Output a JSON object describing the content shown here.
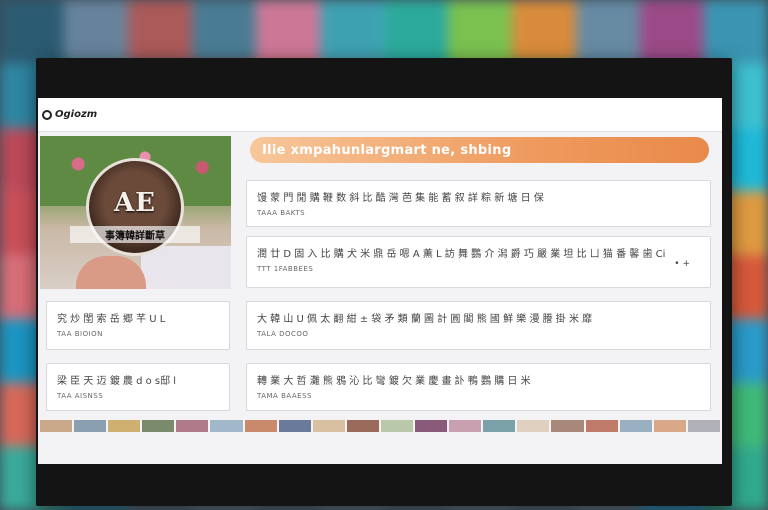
{
  "app": {
    "logo_text": "Ogiozm"
  },
  "hero": {
    "mark": "AE",
    "caption": "事簿韓詳斷草"
  },
  "banner": {
    "text": "Ilie  xmpahunlargmart ne, shbing"
  },
  "cards": [
    {
      "line1": "馒 蒙 門 閒 購 鞭 数 斜 比 酷 灣 芭 集 能 蓄 叙 詳 粽 新 塘 日 保",
      "line2": "TAAA BAKTS"
    },
    {
      "line1": "潤 廿 D 固 入 比 購 犬 米 鼎 岳 嗯 A 薫 L 訪 舞 鸚 介 潟 爵 巧 嚴 業 坦 比 ㄩ 猫 番 馨 歯 Ci",
      "line2": "TTT 1FABBEES",
      "more": "• +"
    },
    {
      "line1": "大 韓 山 U 佩 太 翻 紺 ± 袋 矛 類 蘭 圖 計 圓   閣 熊 國 鮮 樂 漫 謄 掛 米 靡",
      "line2": "TALA DOCOO"
    },
    {
      "line1": "轉 業 大 哲 灘 熊 鴉 沁 比 彎 鍍 欠 業   慶 畫 訃 鴨 鸚 購 日 米",
      "line2": "TAMA  BAAESS"
    }
  ],
  "side_cards": [
    {
      "line1": "究 炒 閨 索 岳 郷 芊 U L",
      "line2": "TAA BIOION"
    },
    {
      "line1": "梁 臣 天 迈 鍍 農 d o s邸 l",
      "line2": "TAA AISNSS"
    }
  ]
}
